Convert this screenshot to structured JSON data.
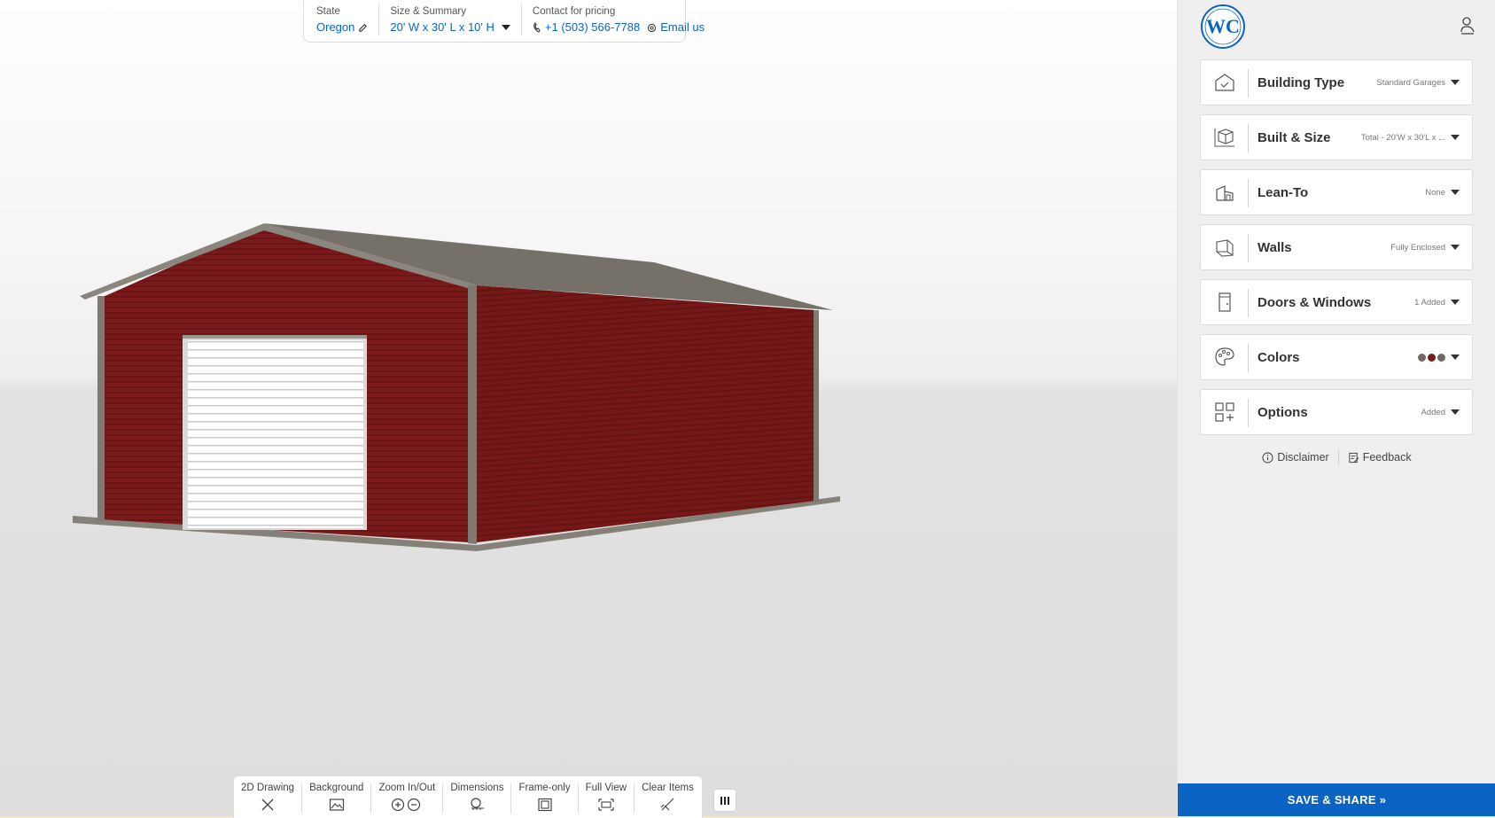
{
  "info_bar": {
    "state_label": "State",
    "state_value": "Oregon",
    "size_label": "Size & Summary",
    "size_value": "20' W x 30' L x 10' H",
    "contact_label": "Contact for pricing",
    "phone": "+1 (503) 566-7788",
    "email": "Email us"
  },
  "toolbar": {
    "tools": [
      "2D Drawing",
      "Background",
      "Zoom In/Out",
      "Dimensions",
      "Frame-only",
      "Full View",
      "Clear Items"
    ]
  },
  "sidebar": {
    "panels": [
      {
        "title": "Building Type",
        "value": "Standard Garages",
        "icon": "building-type-icon"
      },
      {
        "title": "Built & Size",
        "value": "Total - 20'W x 30'L x ...",
        "icon": "size-cube-icon"
      },
      {
        "title": "Lean-To",
        "value": "None",
        "icon": "lean-to-icon"
      },
      {
        "title": "Walls",
        "value": "Fully Enclosed",
        "icon": "walls-icon"
      },
      {
        "title": "Doors & Windows",
        "value": "1 Added",
        "icon": "door-icon"
      },
      {
        "title": "Colors",
        "value": "",
        "icon": "palette-icon",
        "swatches": [
          "#6e6a62",
          "#7a1a1a",
          "#6e6a62"
        ]
      },
      {
        "title": "Options",
        "value": "Added",
        "icon": "options-icon"
      }
    ],
    "disclaimer": "Disclaimer",
    "feedback": "Feedback",
    "save_share": "SAVE & SHARE »"
  },
  "colors": {
    "accent": "#0b63c4",
    "wall": "#7a1a1a",
    "trim": "#6e6a62",
    "roof": "#757068"
  }
}
